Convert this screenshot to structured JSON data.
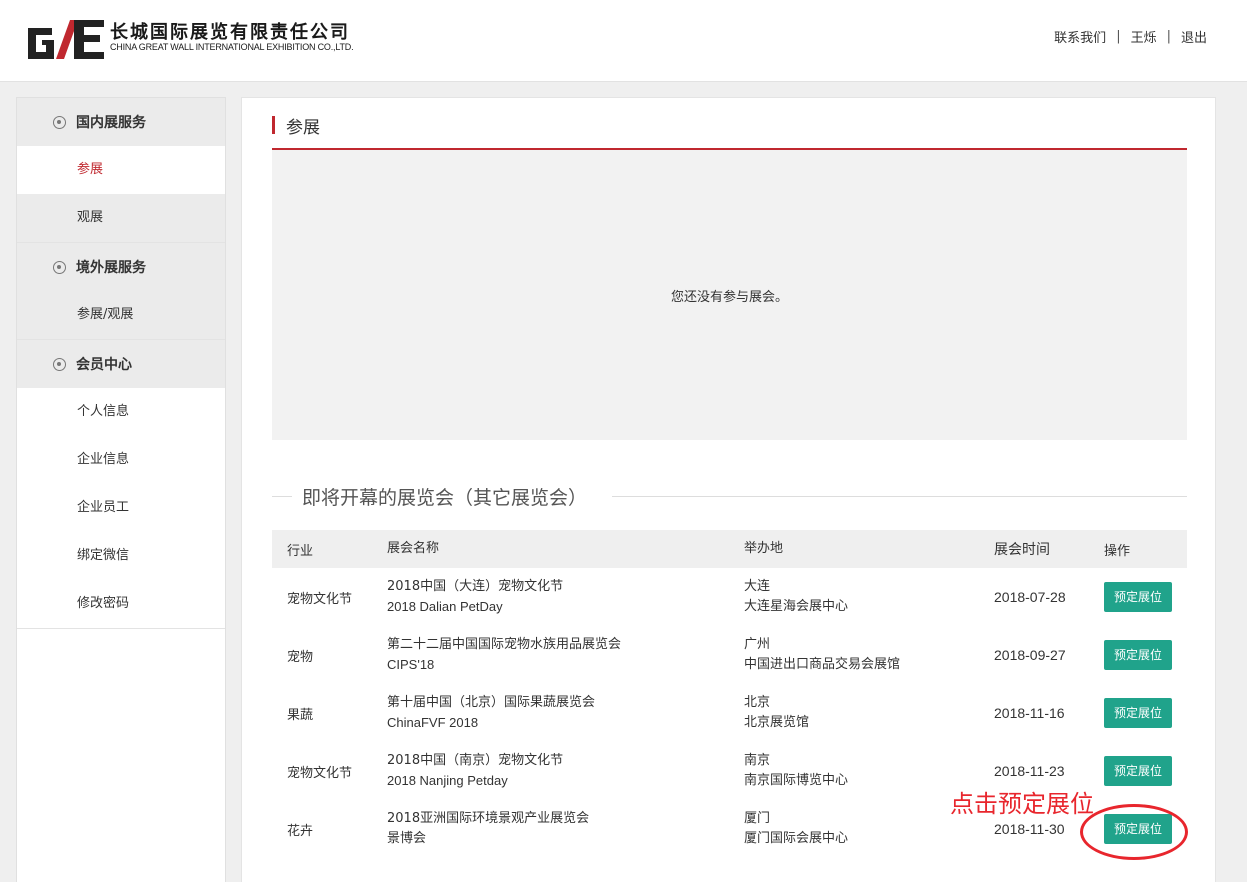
{
  "header": {
    "logo_cn": "长城国际展览有限责任公司",
    "logo_en": "CHINA GREAT WALL INTERNATIONAL EXHIBITION CO.,LTD.",
    "nav": {
      "contact": "联系我们",
      "user": "王烁",
      "logout": "退出",
      "separator": "|"
    }
  },
  "sidebar": {
    "groups": [
      {
        "title": "国内展服务",
        "items": [
          "参展",
          "观展"
        ]
      },
      {
        "title": "境外展服务",
        "items": [
          "参展/观展"
        ]
      },
      {
        "title": "会员中心",
        "items": [
          "个人信息",
          "企业信息",
          "企业员工",
          "绑定微信",
          "修改密码"
        ]
      }
    ],
    "active_item": "参展"
  },
  "main": {
    "section_title": "参展",
    "empty_message": "您还没有参与展会。",
    "upcoming_title": "即将开幕的展览会（其它展览会）",
    "table": {
      "headers": [
        "行业",
        "展会名称",
        "举办地",
        "展会时间",
        "操作"
      ],
      "rows": [
        {
          "industry": "宠物文化节",
          "name": "2018中国（大连）宠物文化节",
          "name_en": "2018 Dalian PetDay",
          "city": "大连",
          "venue": "大连星海会展中心",
          "date": "2018-07-28",
          "action": "预定展位"
        },
        {
          "industry": "宠物",
          "name": "第二十二届中国国际宠物水族用品展览会",
          "name_en": "CIPS'18",
          "city": "广州",
          "venue": "中国进出口商品交易会展馆",
          "date": "2018-09-27",
          "action": "预定展位"
        },
        {
          "industry": "果蔬",
          "name": "第十届中国（北京）国际果蔬展览会",
          "name_en": "ChinaFVF 2018",
          "city": "北京",
          "venue": "北京展览馆",
          "date": "2018-11-16",
          "action": "预定展位"
        },
        {
          "industry": "宠物文化节",
          "name": "2018中国（南京）宠物文化节",
          "name_en": "2018 Nanjing Petday",
          "city": "南京",
          "venue": "南京国际博览中心",
          "date": "2018-11-23",
          "action": "预定展位"
        },
        {
          "industry": "花卉",
          "name": "2018亚洲国际环境景观产业展览会",
          "name_en": "景博会",
          "city": "厦门",
          "venue": "厦门国际会展中心",
          "date": "2018-11-30",
          "action": "预定展位"
        }
      ]
    }
  },
  "annotation": {
    "text": "点击预定展位",
    "color": "#e8262d"
  },
  "colors": {
    "brand_red": "#c0282f",
    "button_green": "#20a38b"
  }
}
